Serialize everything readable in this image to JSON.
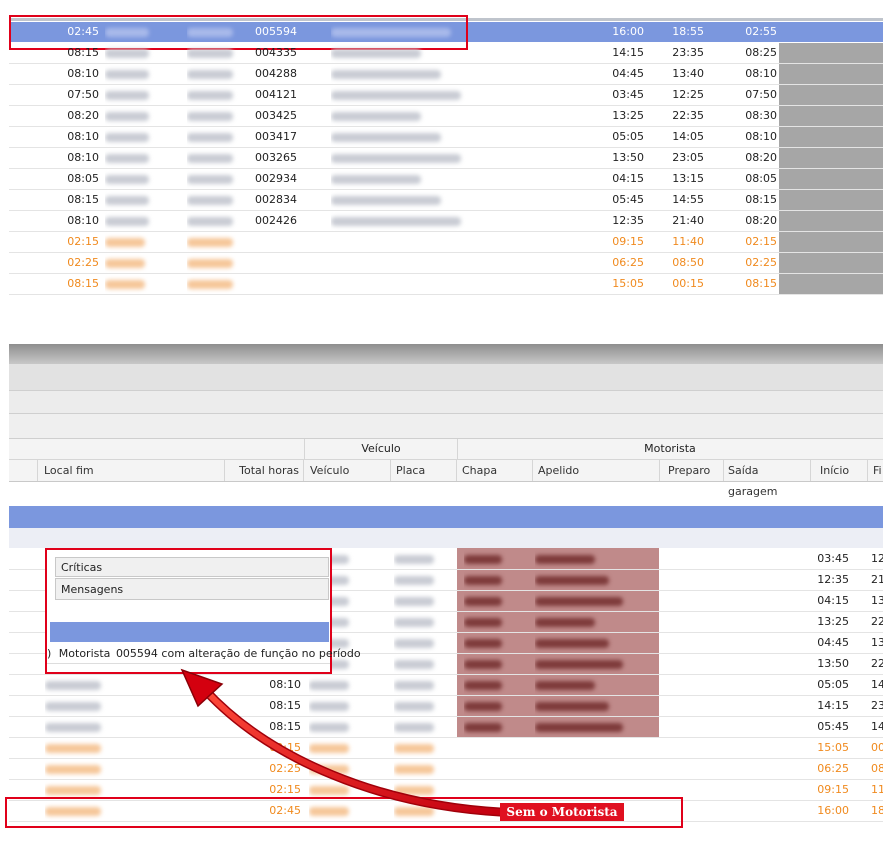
{
  "top_table": {
    "selected_row": {
      "c1": "02:45",
      "c3": "005594",
      "c4": "16:00",
      "c5": "18:55",
      "c6": "02:55"
    },
    "rows": [
      {
        "c1": "08:15",
        "c3": "004335",
        "c4": "14:15",
        "c5": "23:35",
        "c6": "08:25"
      },
      {
        "c1": "08:10",
        "c3": "004288",
        "c4": "04:45",
        "c5": "13:40",
        "c6": "08:10"
      },
      {
        "c1": "07:50",
        "c3": "004121",
        "c4": "03:45",
        "c5": "12:25",
        "c6": "07:50"
      },
      {
        "c1": "08:20",
        "c3": "003425",
        "c4": "13:25",
        "c5": "22:35",
        "c6": "08:30"
      },
      {
        "c1": "08:10",
        "c3": "003417",
        "c4": "05:05",
        "c5": "14:05",
        "c6": "08:10"
      },
      {
        "c1": "08:10",
        "c3": "003265",
        "c4": "13:50",
        "c5": "23:05",
        "c6": "08:20"
      },
      {
        "c1": "08:05",
        "c3": "002934",
        "c4": "04:15",
        "c5": "13:15",
        "c6": "08:05"
      },
      {
        "c1": "08:15",
        "c3": "002834",
        "c4": "05:45",
        "c5": "14:55",
        "c6": "08:15"
      },
      {
        "c1": "08:10",
        "c3": "002426",
        "c4": "12:35",
        "c5": "21:40",
        "c6": "08:20"
      }
    ],
    "orange_rows": [
      {
        "c1": "02:15",
        "c4": "09:15",
        "c5": "11:40",
        "c6": "02:15"
      },
      {
        "c1": "02:25",
        "c4": "06:25",
        "c5": "08:50",
        "c6": "02:25"
      },
      {
        "c1": "08:15",
        "c4": "15:05",
        "c5": "00:15",
        "c6": "08:15"
      }
    ]
  },
  "bottom_table": {
    "group_headers": {
      "veiculo": "Veículo",
      "motorista": "Motorista"
    },
    "columns": {
      "local_fim": "Local fim",
      "total_horas": "Total horas",
      "veiculo": "Veículo",
      "placa": "Placa",
      "chapa": "Chapa",
      "apelido": "Apelido",
      "preparo": "Preparo",
      "saida_garagem": "Saída garagem",
      "inicio": "Início",
      "fim": "Fi"
    },
    "rows": [
      {
        "total": "",
        "inicio": "03:45",
        "fim": "12"
      },
      {
        "total": "",
        "inicio": "12:35",
        "fim": "21"
      },
      {
        "total": "",
        "inicio": "04:15",
        "fim": "13"
      },
      {
        "total": "",
        "inicio": "13:25",
        "fim": "22"
      },
      {
        "total": "",
        "inicio": "04:45",
        "fim": "13"
      },
      {
        "total": "",
        "inicio": "13:50",
        "fim": "22"
      },
      {
        "total": "08:10",
        "inicio": "05:05",
        "fim": "14"
      },
      {
        "total": "08:15",
        "inicio": "14:15",
        "fim": "23"
      },
      {
        "total": "08:15",
        "inicio": "05:45",
        "fim": "14"
      }
    ],
    "orange_rows": [
      {
        "total": "02:15",
        "inicio": "15:05",
        "fim": "00"
      },
      {
        "total": "02:25",
        "inicio": "06:25",
        "fim": "08"
      },
      {
        "total": "02:15",
        "inicio": "09:15",
        "fim": "11"
      },
      {
        "total": "02:45",
        "inicio": "16:00",
        "fim": "18"
      }
    ]
  },
  "popup": {
    "tab_criticas": "Críticas",
    "tab_mensagens": "Mensagens",
    "message_prefix": ")",
    "message_label": "Motorista",
    "message_text": "005594 com alteração de função no período"
  },
  "annotation": {
    "label": "Sem o Motorista"
  },
  "colors": {
    "selected": "#7b97de",
    "orange": "#f08a1e",
    "red": "#e0001a",
    "gray_col": "#a6a6a6"
  }
}
